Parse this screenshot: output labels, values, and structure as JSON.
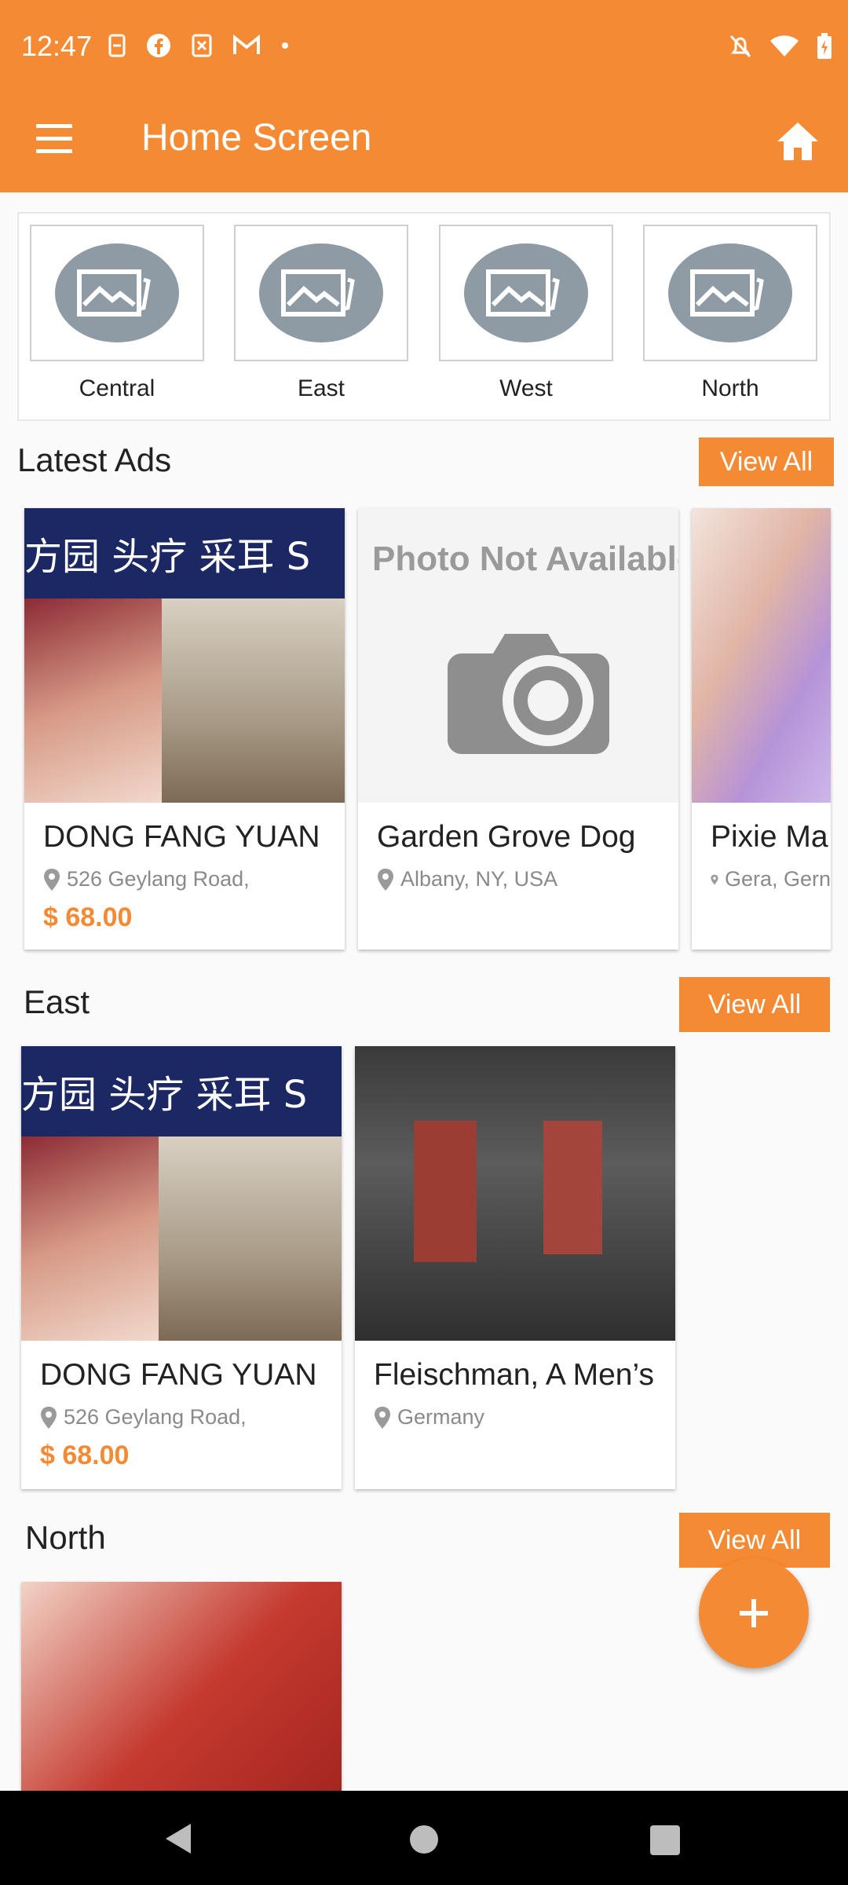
{
  "status_bar": {
    "time": "12:47"
  },
  "app_bar": {
    "title": "Home Screen"
  },
  "categories": [
    {
      "label": "Central"
    },
    {
      "label": "East"
    },
    {
      "label": "West"
    },
    {
      "label": "North"
    }
  ],
  "sections": {
    "latest": {
      "title": "Latest Ads",
      "view_all": "View All",
      "cards": [
        {
          "name": "DONG FANG YUAN",
          "location": "526 Geylang Road,",
          "price": "$ 68.00"
        },
        {
          "name": "Garden Grove Dog",
          "location": "Albany, NY, USA",
          "price": "",
          "image_text": "Photo Not Available"
        },
        {
          "name": "Pixie Ma",
          "location": "Gera, Gern",
          "price": ""
        }
      ]
    },
    "east": {
      "title": "East",
      "view_all": "View All",
      "cards": [
        {
          "name": "DONG FANG YUAN",
          "location": "526 Geylang Road,",
          "price": "$ 68.00"
        },
        {
          "name": "Fleischman, A Men’s",
          "location": "Germany",
          "price": ""
        }
      ]
    },
    "north": {
      "title": "North",
      "view_all": "View All"
    }
  },
  "signage_text": "方园 头疗 采耳 S",
  "fab": {
    "icon": "plus-icon",
    "label": "+"
  },
  "colors": {
    "accent": "#f58a34",
    "placeholder": "#8e9ba5"
  }
}
